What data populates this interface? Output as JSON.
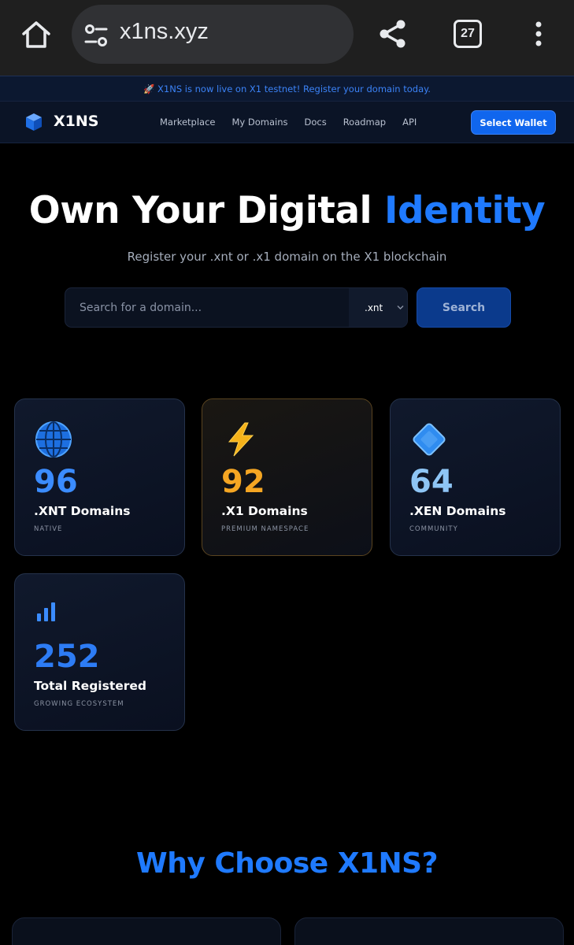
{
  "browser": {
    "url": "x1ns.xyz",
    "tab_count": "27"
  },
  "announcement": "🚀 X1NS is now live on X1 testnet! Register your domain today.",
  "nav": {
    "logo": "X1NS",
    "links": [
      "Marketplace",
      "My Domains",
      "Docs",
      "Roadmap",
      "API"
    ],
    "wallet_button": "Select Wallet"
  },
  "hero": {
    "title": "Own Your Digital",
    "title_accent": "Identity",
    "subtitle": "Register your .xnt or .x1 domain on the X1 blockchain",
    "search_placeholder": "Search for a domain...",
    "tld_selected": ".xnt",
    "search_button": "Search"
  },
  "stats": [
    {
      "icon": "globe-icon",
      "value": "96",
      "label": ".XNT Domains",
      "sub": "NATIVE",
      "color": "#3b8cff"
    },
    {
      "icon": "lightning-icon",
      "value": "92",
      "label": ".X1 Domains",
      "sub": "PREMIUM NAMESPACE",
      "color": "#f5a623"
    },
    {
      "icon": "diamond-icon",
      "value": "64",
      "label": ".XEN Domains",
      "sub": "COMMUNITY",
      "color": "#8ec5f5"
    },
    {
      "icon": "bar-chart-icon",
      "value": "252",
      "label": "Total Registered",
      "sub": "GROWING ECOSYSTEM",
      "color": "#2d7cf5"
    }
  ],
  "why_title": "Why Choose X1NS?",
  "colors": {
    "accent": "#1f7aff",
    "background": "#000000"
  }
}
